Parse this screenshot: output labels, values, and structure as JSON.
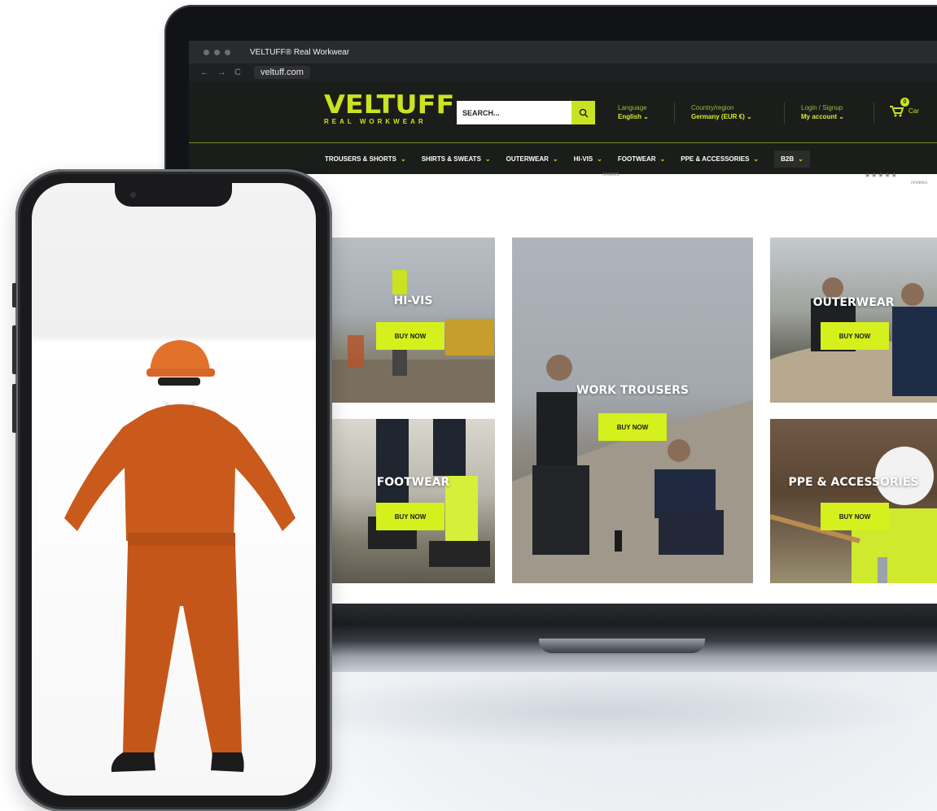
{
  "browser": {
    "tab_title": "VELTUFF® Real Workwear",
    "url": "veltuff.com"
  },
  "header": {
    "logo_word": "VELTUFF",
    "logo_tagline": "REAL WORKWEAR",
    "search_placeholder": "SEARCH...",
    "language_label": "Language",
    "language_value": "English",
    "country_label": "Country/region",
    "country_value": "Germany (EUR €)",
    "account_label": "Login / Signup",
    "account_value": "My account",
    "cart_count": "0",
    "cart_label": "Car"
  },
  "nav": {
    "items": [
      "TROUSERS & SHORTS",
      "SHIRTS & SWEATS",
      "OUTERWEAR",
      "HI-VIS",
      "FOOTWEAR",
      "PPE & ACCESSORIES",
      "B2B"
    ]
  },
  "reviews": {
    "text_a": "reviews",
    "stars": "★★★★★",
    "text_b": "reviews"
  },
  "cards": {
    "hivis": {
      "title": "HI-VIS",
      "button": "BUY NOW"
    },
    "trousers": {
      "title": "WORK TROUSERS",
      "button": "BUY NOW"
    },
    "outerwear": {
      "title": "OUTERWEAR",
      "button": "BUY NOW"
    },
    "footwear": {
      "title": "FOOTWEAR",
      "button": "BUY NOW"
    },
    "ppe": {
      "title": "PPE & ACCESSORIES",
      "button": "BUY NOW"
    }
  },
  "colors": {
    "brand_lime": "#c9e321",
    "header_bg": "#1b1d1a",
    "coverall_orange": "#c95a1c"
  },
  "icons": {
    "search": "search-icon",
    "chevron": "chevron-down-icon",
    "cart": "cart-icon"
  }
}
